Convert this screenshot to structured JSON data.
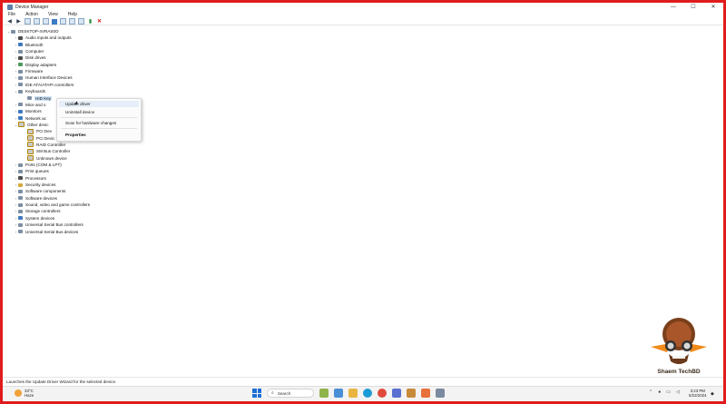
{
  "window": {
    "title": "Device Manager",
    "controls": [
      "—",
      "☐",
      "✕"
    ]
  },
  "menu": [
    "File",
    "Action",
    "View",
    "Help"
  ],
  "tree": {
    "root": "DESKTOP-4VRAS0O",
    "items": [
      {
        "label": "Audio inputs and outputs",
        "arrow": "›",
        "icon": "speaker-icon",
        "color": "dark"
      },
      {
        "label": "Bluetooth",
        "arrow": "›",
        "icon": "bluetooth-icon",
        "color": "blue"
      },
      {
        "label": "Computer",
        "arrow": "›",
        "icon": "computer-icon",
        "color": ""
      },
      {
        "label": "Disk drives",
        "arrow": "›",
        "icon": "disk-icon",
        "color": "dark"
      },
      {
        "label": "Display adapters",
        "arrow": "›",
        "icon": "display-icon",
        "color": "green"
      },
      {
        "label": "Firmware",
        "arrow": "›",
        "icon": "firmware-icon",
        "color": ""
      },
      {
        "label": "Human Interface Devices",
        "arrow": "›",
        "icon": "hid-icon",
        "color": ""
      },
      {
        "label": "IDE ATA/ATAPI controllers",
        "arrow": "›",
        "icon": "ide-icon",
        "color": ""
      },
      {
        "label": "Keyboards",
        "arrow": "⌄",
        "icon": "keyboard-icon",
        "color": ""
      },
      {
        "label": "HID Key",
        "arrow": "",
        "icon": "keyboard-icon",
        "color": "",
        "child": true,
        "selected": true
      },
      {
        "label": "Mice and o",
        "arrow": "›",
        "icon": "mouse-icon",
        "color": ""
      },
      {
        "label": "Monitors",
        "arrow": "›",
        "icon": "monitor-icon",
        "color": "blue"
      },
      {
        "label": "Network ac",
        "arrow": "›",
        "icon": "network-icon",
        "color": "blue"
      },
      {
        "label": "Other devic",
        "arrow": "⌄",
        "icon": "other-devices-icon",
        "color": "warn"
      },
      {
        "label": "PCI Dev",
        "arrow": "",
        "icon": "warning-device-icon",
        "color": "warn",
        "child": true
      },
      {
        "label": "PCI Devic",
        "arrow": "",
        "icon": "warning-device-icon",
        "color": "warn",
        "child": true
      },
      {
        "label": "RAID Controller",
        "arrow": "",
        "icon": "warning-device-icon",
        "color": "warn",
        "child": true
      },
      {
        "label": "SM Bus Controller",
        "arrow": "",
        "icon": "warning-device-icon",
        "color": "warn",
        "child": true
      },
      {
        "label": "Unknown device",
        "arrow": "",
        "icon": "warning-device-icon",
        "color": "warn",
        "child": true
      },
      {
        "label": "Ports (COM & LPT)",
        "arrow": "›",
        "icon": "port-icon",
        "color": ""
      },
      {
        "label": "Print queues",
        "arrow": "›",
        "icon": "printer-icon",
        "color": ""
      },
      {
        "label": "Processors",
        "arrow": "›",
        "icon": "processor-icon",
        "color": "dark"
      },
      {
        "label": "Security devices",
        "arrow": "›",
        "icon": "security-icon",
        "color": "yellow"
      },
      {
        "label": "Software components",
        "arrow": "›",
        "icon": "component-icon",
        "color": ""
      },
      {
        "label": "Software devices",
        "arrow": "›",
        "icon": "software-device-icon",
        "color": ""
      },
      {
        "label": "Sound, video and game controllers",
        "arrow": "›",
        "icon": "sound-icon",
        "color": ""
      },
      {
        "label": "Storage controllers",
        "arrow": "›",
        "icon": "storage-icon",
        "color": ""
      },
      {
        "label": "System devices",
        "arrow": "›",
        "icon": "system-icon",
        "color": "blue"
      },
      {
        "label": "Universal Serial Bus controllers",
        "arrow": "›",
        "icon": "usb-icon",
        "color": ""
      },
      {
        "label": "Universal Serial Bus devices",
        "arrow": "›",
        "icon": "usb-icon",
        "color": ""
      }
    ]
  },
  "context_menu": {
    "update": "Update driver",
    "uninstall": "Uninstall device",
    "scan": "Scan for hardware changes",
    "properties": "Properties"
  },
  "status": "Launches the Update Driver Wizard for the selected device.",
  "taskbar": {
    "temp": "33°C",
    "condition": "Haze",
    "search": "Search",
    "time": "3:23 PM",
    "date": "5/22/2024"
  },
  "watermark": "Shaem TechBD",
  "colors": {
    "frame": "#e11b1b",
    "accent": "#1d6fd6"
  }
}
